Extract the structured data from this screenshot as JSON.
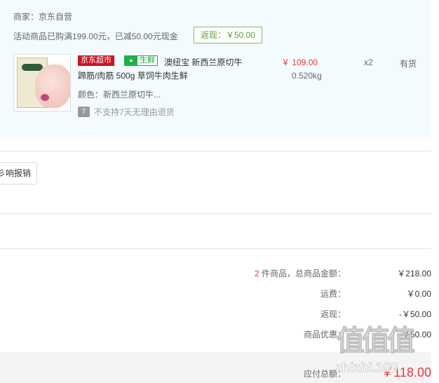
{
  "store": {
    "seller": "商家：京东自营",
    "promo": "活动商品已购满199.00元，已减50.00元现金",
    "cashback_tag": "返现：￥50.00"
  },
  "item": {
    "badge_jd": "京东超市",
    "badge_fresh_icon": "fish-icon",
    "badge_fresh": "生鲜",
    "title_line1": "澳纽宝 新西兰原切牛",
    "title_line2": "蹄筋/肉筋 500g 草饲牛肉生鲜",
    "color": "颜色：新西兰原切牛...",
    "return_icon": "7",
    "return_policy": "不支持7天无理由退货",
    "price": "￥ 109.00",
    "weight": "0.520kg",
    "qty": "x2",
    "stock": "有货"
  },
  "invoice_button": "彡响报销",
  "summary": {
    "items_count": "2",
    "items_label": "件商品，总商品金额：",
    "items_value": "￥218.00",
    "shipping_label": "运费：",
    "shipping_value": "￥0.00",
    "cashback_label": "返现：",
    "cashback_value": "-￥50.00",
    "discount_label": "商品优惠：",
    "discount_value": "-￥50.00"
  },
  "total": {
    "label": "应付总额：",
    "value": "￥118.00"
  },
  "watermark": {
    "glyphs": "值值值",
    "url": "zhizhi.100"
  },
  "colors": {
    "accent_red": "#e4393c",
    "jd_red": "#c81623",
    "fresh_green": "#20b04a",
    "panel_bg": "#f3fbfe"
  }
}
